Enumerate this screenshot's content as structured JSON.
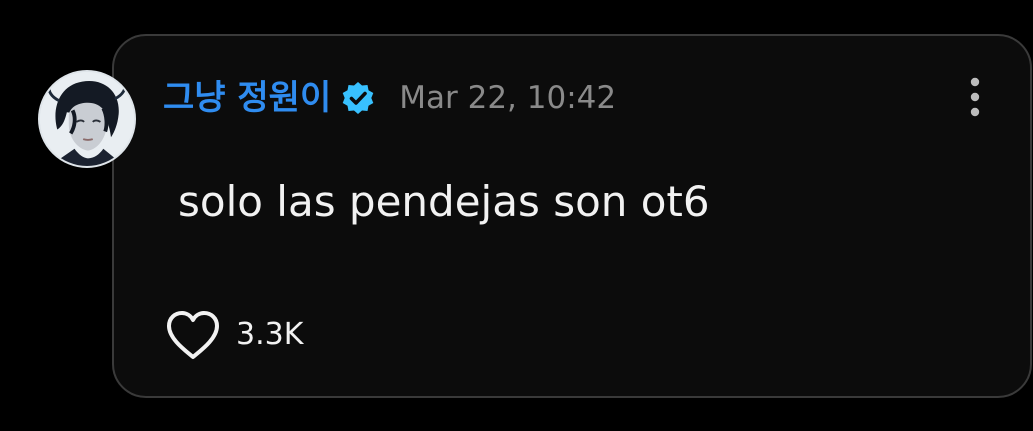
{
  "post": {
    "username": "그냥 정원이",
    "timestamp": "Mar 22, 10:42",
    "text": "solo las pendejas son ot6",
    "like_count": "3.3K"
  },
  "icons": {
    "verified": "verified-badge-icon",
    "menu": "more-vertical-icon",
    "like": "heart-outline-icon",
    "avatar": "profile-avatar"
  },
  "colors": {
    "background": "#000000",
    "card": "#0c0c0c",
    "card_border": "#3a3a3a",
    "username": "#2f8cf0",
    "verified": "#38c1ff",
    "timestamp": "#8a8a8a",
    "text": "#f2f2f2"
  }
}
